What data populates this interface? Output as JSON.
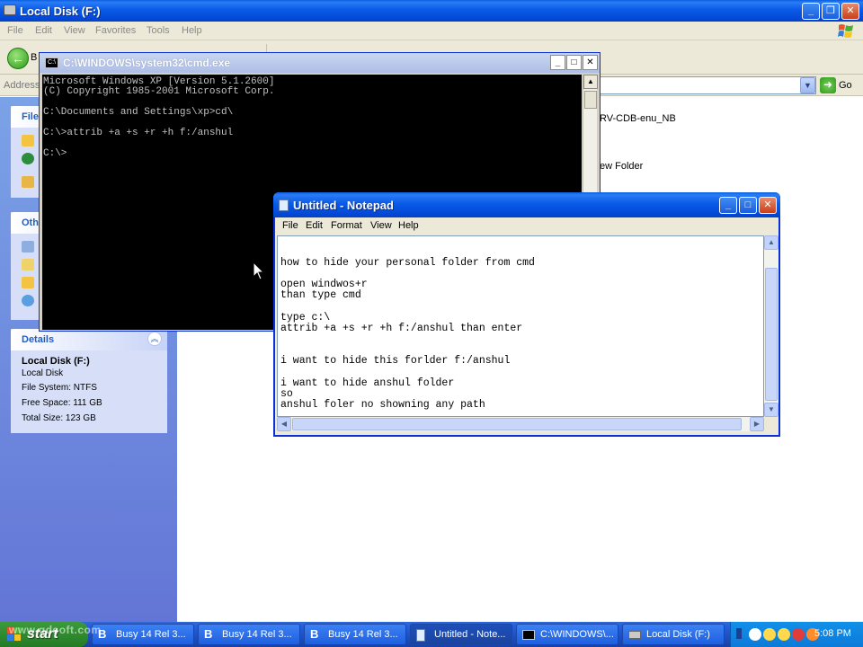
{
  "explorer": {
    "title": "Local Disk (F:)",
    "menu": [
      "File",
      "Edit",
      "View",
      "Favorites",
      "Tools",
      "Help"
    ],
    "back_label": "B",
    "address_label": "Address",
    "go_label": "Go",
    "files": [
      "RV-CDB-enu_NB",
      "ew Folder"
    ],
    "task_pane": {
      "file_tasks_head": "File",
      "other_places_head": "Oth",
      "details": {
        "head": "Details",
        "name": "Local Disk (F:)",
        "type": "Local Disk",
        "file_system": "File System: NTFS",
        "free_space": "Free Space: 111 GB",
        "total_size": "Total Size: 123 GB"
      }
    }
  },
  "cmd": {
    "title": "C:\\WINDOWS\\system32\\cmd.exe",
    "lines": [
      "Microsoft Windows XP [Version 5.1.2600]",
      "(C) Copyright 1985-2001 Microsoft Corp.",
      "",
      "C:\\Documents and Settings\\xp>cd\\",
      "",
      "C:\\>attrib +a +s +r +h f:/anshul",
      "",
      "C:\\>"
    ]
  },
  "notepad": {
    "title": "Untitled - Notepad",
    "menu": [
      "File",
      "Edit",
      "Format",
      "View",
      "Help"
    ],
    "lines": [
      "",
      "",
      "how to hide your personal folder from cmd",
      "",
      "open windwos+r",
      "than type cmd",
      "",
      "type c:\\",
      "attrib +a +s +r +h f:/anshul than enter",
      "",
      "",
      "i want to hide this forlder f:/anshul",
      "",
      "i want to hide anshul folder",
      "so",
      "anshul foler no showning any path"
    ]
  },
  "taskbar": {
    "start_label": "start",
    "watermark": "www.qdsoft.com",
    "buttons": [
      "Busy 14 Rel 3...",
      "Busy 14 Rel 3...",
      "Busy 14 Rel 3...",
      "Untitled - Note...",
      "C:\\WINDOWS\\...",
      "Local Disk (F:)"
    ],
    "clock": "5:08 PM"
  }
}
